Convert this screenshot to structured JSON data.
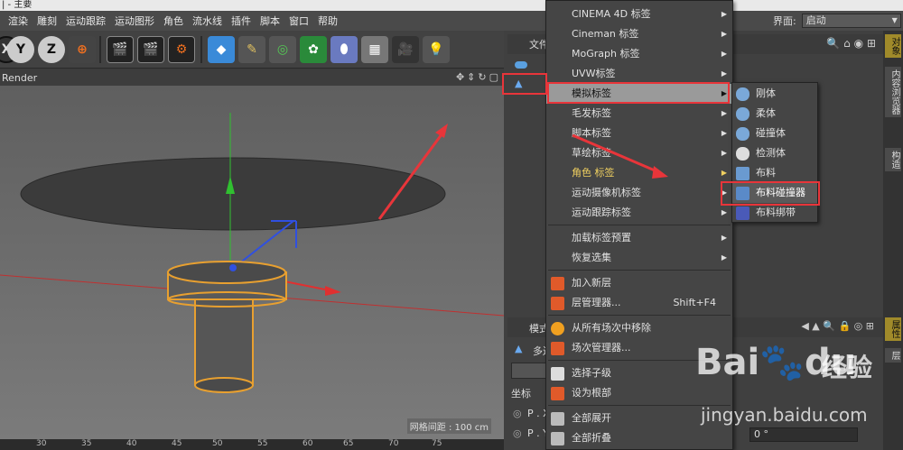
{
  "window": {
    "title": "| - 主要"
  },
  "menubar": {
    "items": [
      "渲染",
      "雕刻",
      "运动跟踪",
      "运动图形",
      "角色",
      "流水线",
      "插件",
      "脚本",
      "窗口",
      "帮助"
    ]
  },
  "layout": {
    "label": "界面:",
    "value": "启动"
  },
  "viewport": {
    "name": "Render",
    "grid_status": "网格间距 : 100 cm"
  },
  "ruler": {
    "ticks": [
      "30",
      "35",
      "40",
      "45",
      "50",
      "55",
      "60",
      "65",
      "70",
      "75"
    ]
  },
  "object_manager": {
    "title": "文件"
  },
  "attribute_manager": {
    "title": "模式",
    "object_label": "多边",
    "coord_label": "坐标",
    "p_x": "P . X",
    "p_y": "P . Y",
    "zero": "0 °"
  },
  "side_tabs": [
    "对象",
    "内容浏览器",
    "构造",
    "属性",
    "层"
  ],
  "context_menu": {
    "items": [
      {
        "label": "CINEMA 4D 标签",
        "submenu": true
      },
      {
        "label": "Cineman 标签",
        "submenu": true
      },
      {
        "label": "MoGraph 标签",
        "submenu": true
      },
      {
        "label": "UVW标签",
        "submenu": true
      },
      {
        "label": "模拟标签",
        "submenu": true,
        "highlighted": true
      },
      {
        "label": "毛发标签",
        "submenu": true
      },
      {
        "label": "脚本标签",
        "submenu": true
      },
      {
        "label": "草绘标签",
        "submenu": true
      },
      {
        "label": "角色 标签",
        "submenu": true
      },
      {
        "label": "运动摄像机标签",
        "submenu": true
      },
      {
        "label": "运动跟踪标签",
        "submenu": true
      },
      {
        "label": "加载标签预置",
        "submenu": true
      },
      {
        "label": "恢复选集",
        "submenu": true
      },
      {
        "label": "加入新层"
      },
      {
        "label": "层管理器...",
        "shortcut": "Shift+F4"
      },
      {
        "label": "从所有场次中移除"
      },
      {
        "label": "场次管理器..."
      },
      {
        "label": "选择子级"
      },
      {
        "label": "设为根部"
      },
      {
        "label": "全部展开"
      },
      {
        "label": "全部折叠"
      }
    ]
  },
  "submenu": {
    "items": [
      {
        "label": "刚体"
      },
      {
        "label": "柔体"
      },
      {
        "label": "碰撞体"
      },
      {
        "label": "检测体"
      },
      {
        "label": "布料"
      },
      {
        "label": "布料碰撞器",
        "highlighted": true
      },
      {
        "label": "布料绑带"
      }
    ]
  },
  "watermark": {
    "brand": "Bai",
    "brand2": "du",
    "cn": "经验",
    "url": "jingyan.baidu.com"
  },
  "colors": {
    "accent_red": "#e8353a",
    "axis_green": "#30c030",
    "axis_red": "#e03030",
    "axis_blue": "#3050e0",
    "selection_orange": "#e8a030"
  }
}
